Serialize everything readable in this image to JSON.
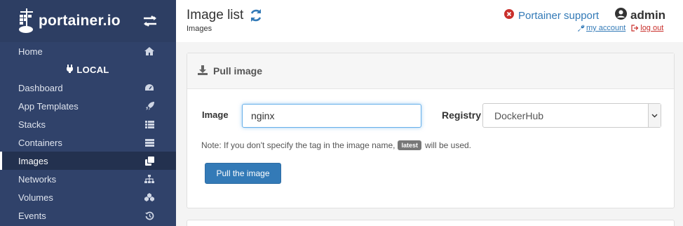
{
  "app": {
    "brand": "portainer.io"
  },
  "sidebar": {
    "home_label": "Home",
    "section_label": "LOCAL",
    "items": [
      {
        "label": "Dashboard",
        "icon": "tachometer-icon"
      },
      {
        "label": "App Templates",
        "icon": "rocket-icon"
      },
      {
        "label": "Stacks",
        "icon": "th-list-icon"
      },
      {
        "label": "Containers",
        "icon": "server-icon"
      },
      {
        "label": "Images",
        "icon": "clone-icon",
        "active": true
      },
      {
        "label": "Networks",
        "icon": "sitemap-icon"
      },
      {
        "label": "Volumes",
        "icon": "cubes-icon"
      },
      {
        "label": "Events",
        "icon": "history-icon"
      }
    ]
  },
  "header": {
    "title": "Image list",
    "breadcrumb": "Images",
    "support_label": "Portainer support",
    "user_name": "admin",
    "my_account_label": "my account",
    "logout_label": "log out"
  },
  "pull": {
    "heading": "Pull image",
    "image_label": "Image",
    "image_value": "nginx",
    "registry_label": "Registry",
    "registry_value": "DockerHub",
    "note_prefix": "Note: If you don't specify the tag in the image name,",
    "note_badge": "latest",
    "note_suffix": "will be used.",
    "button_label": "Pull the image"
  },
  "colors": {
    "sidebar_bg": "#30426a",
    "sidebar_active": "#23314f",
    "primary": "#337ab7",
    "danger": "#c9302c"
  }
}
